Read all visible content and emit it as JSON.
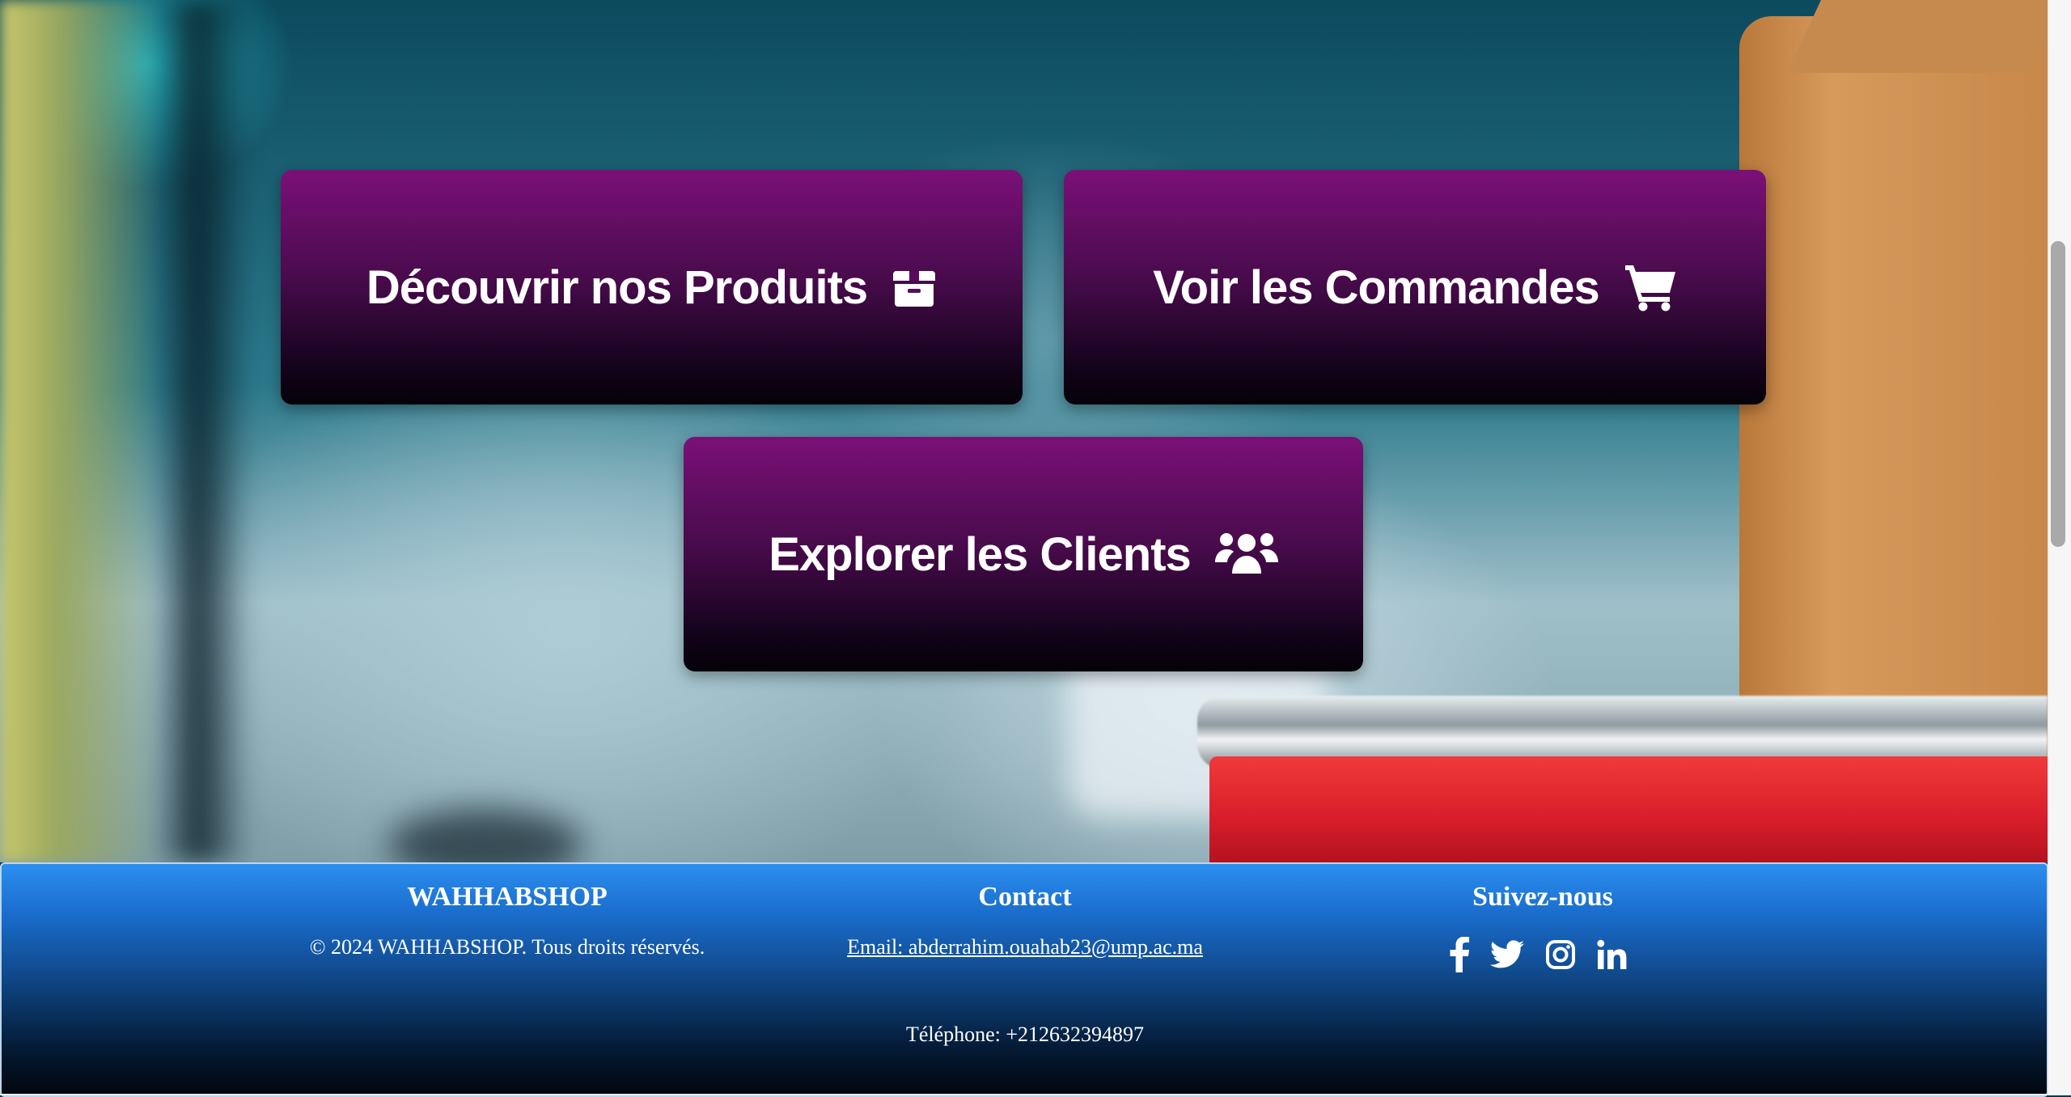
{
  "actions": {
    "products": {
      "label": "Découvrir nos Produits",
      "icon": "box-icon"
    },
    "orders": {
      "label": "Voir les Commandes",
      "icon": "shopping-cart-icon"
    },
    "clients": {
      "label": "Explorer les Clients",
      "icon": "users-icon"
    }
  },
  "footer": {
    "brand": {
      "title": "WAHHABSHOP",
      "copyright": "© 2024 WAHHABSHOP. Tous droits réservés."
    },
    "contact": {
      "title": "Contact",
      "email": "Email: abderrahim.ouahab23@ump.ac.ma",
      "phone": "Téléphone: +212632394897"
    },
    "follow": {
      "title": "Suivez-nous",
      "socials": [
        "facebook-icon",
        "twitter-icon",
        "instagram-icon",
        "linkedin-icon"
      ]
    }
  },
  "colors": {
    "button_top": "#7b1078",
    "button_bottom": "#050108",
    "footer_top": "#2b8ff0",
    "footer_bottom": "#01060d"
  }
}
